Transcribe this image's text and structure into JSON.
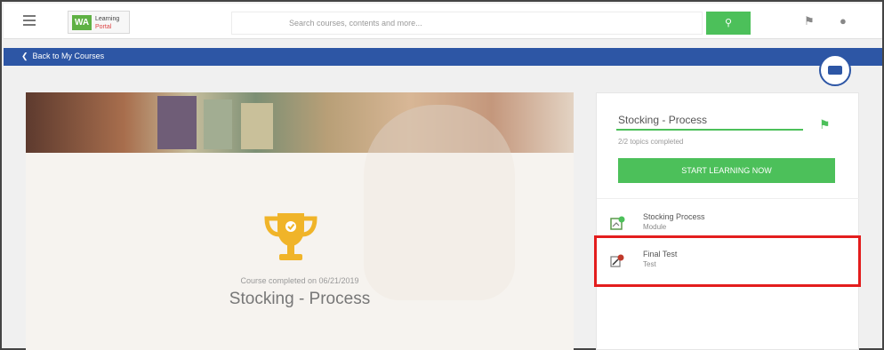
{
  "header": {
    "logo_mark": "WA",
    "logo_line1": "Learning",
    "logo_line2": "Portal",
    "search_placeholder": "Search courses, contents and more...",
    "search_icon": "search-icon",
    "trophy_icon": "trophy-icon",
    "user_icon": "user-icon"
  },
  "nav": {
    "back_label": "Back to My Courses"
  },
  "hero": {
    "completed_text": "Course completed on 06/21/2019",
    "title": "Stocking - Process"
  },
  "panel": {
    "title": "Stocking - Process",
    "progress": "2/2 topics completed",
    "start_button": "START LEARNING NOW",
    "items": [
      {
        "name": "Stocking Process",
        "sub": "Module",
        "icon": "module-icon"
      },
      {
        "name": "Final Test",
        "sub": "Test",
        "icon": "test-icon"
      }
    ]
  },
  "colors": {
    "accent_green": "#4cc05a",
    "nav_blue": "#2d56a5",
    "trophy_gold": "#f0b429",
    "highlight_red": "#e31d1d"
  }
}
